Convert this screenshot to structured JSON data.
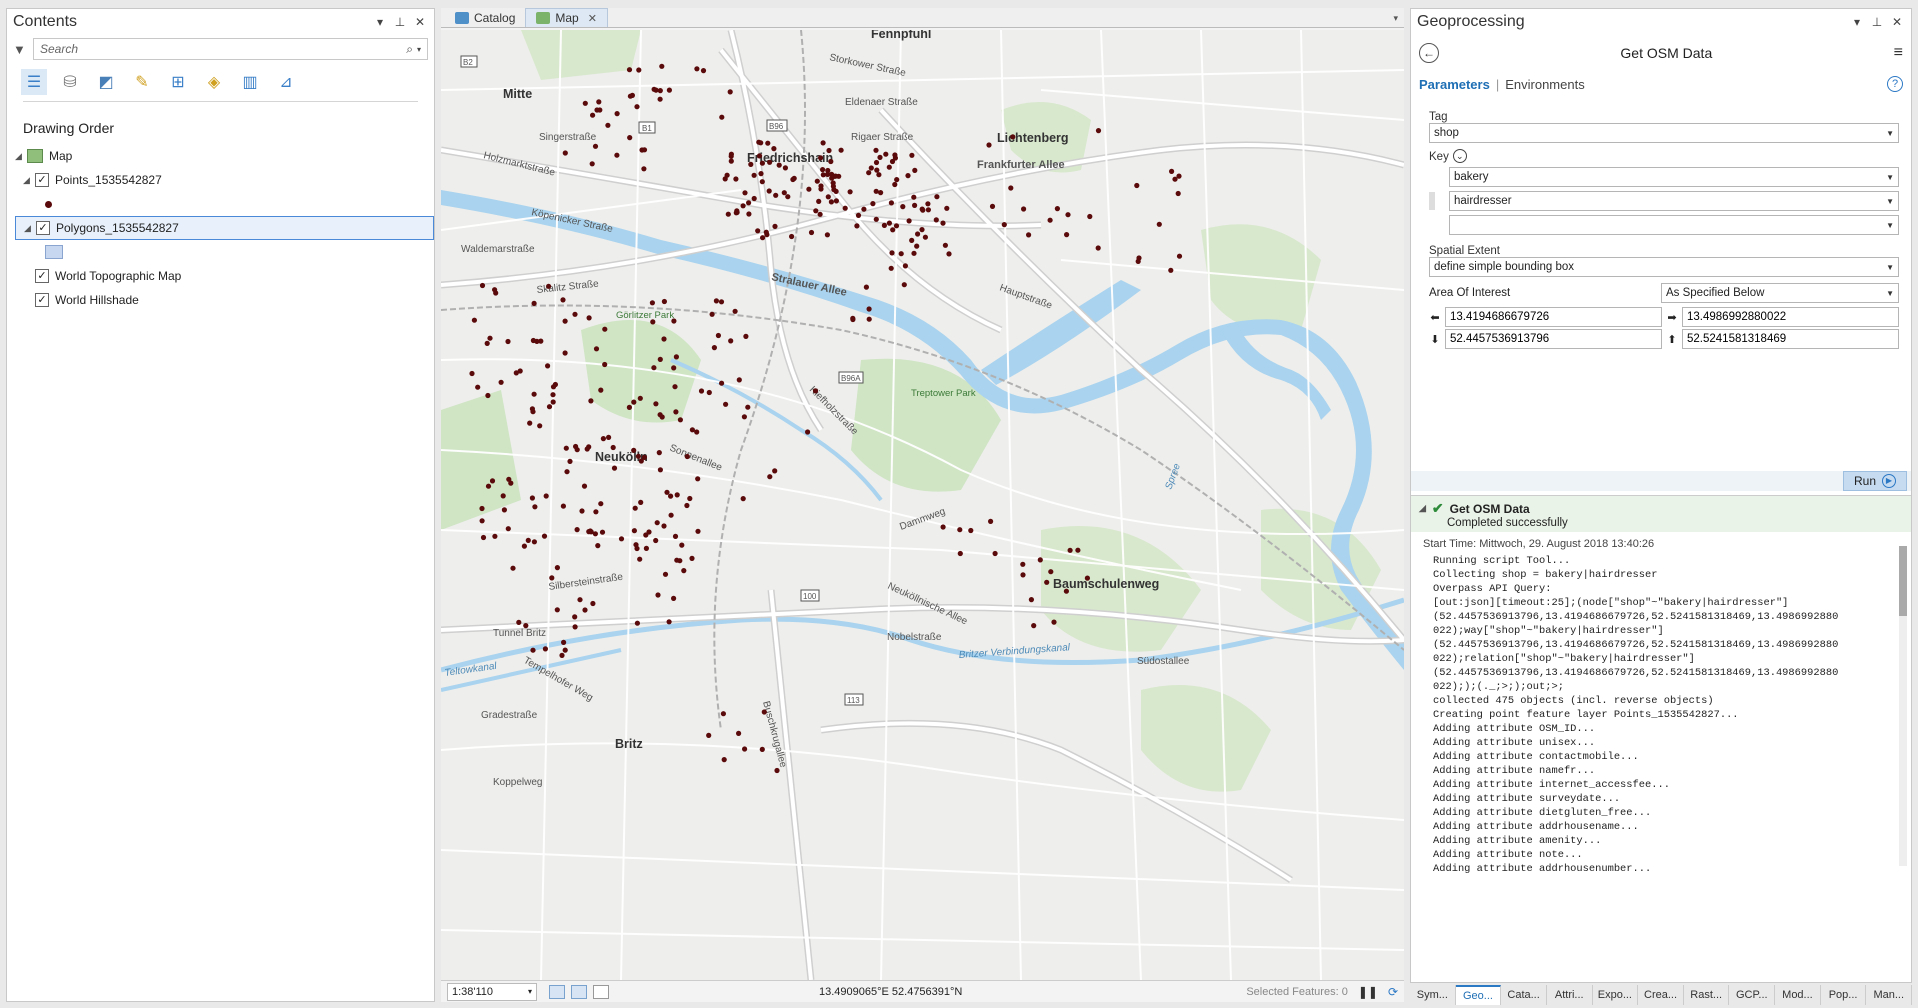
{
  "contents": {
    "title": "Contents",
    "search_placeholder": "Search",
    "drawing_order": "Drawing Order",
    "layers": {
      "map": "Map",
      "points": "Points_1535542827",
      "polygons": "Polygons_1535542827",
      "topo": "World Topographic Map",
      "hillshade": "World Hillshade"
    }
  },
  "map_tabs": {
    "catalog": "Catalog",
    "map": "Map"
  },
  "map_status": {
    "scale": "1:38'110",
    "coordinates": "13.4909065°E 52.4756391°N",
    "selected_features": "Selected Features: 0"
  },
  "map_labels": {
    "mitte": "Mitte",
    "friedrichshain": "Friedrichshain",
    "lichtenberg": "Lichtenberg",
    "neukolln": "Neukölln",
    "baumschulenweg": "Baumschulenweg",
    "britz": "Britz",
    "fennpfuhl": "Fennpfuhl",
    "stralauer": "Stralauer Allee",
    "frankfurter": "Frankfurter Allee",
    "sonnenallee": "Sonnenallee",
    "treptower": "Treptower Park",
    "gorlitzer": "Görlitzer Park",
    "verbindungskanal": "Britzer Verbindungskanal",
    "teltowkanal": "Teltowkanal",
    "tunnel": "Tunnel Britz",
    "spree": "Spree",
    "holzmarkt": "Holzmarktstraße",
    "skalitzer": "Skalitz  Straße",
    "kopenicker": "Köpenicker Straße",
    "waldemar": "Waldemarstraße",
    "landsberger": "Eldenaer Straße",
    "storkower": "Storkower Straße",
    "karl": "Rigaer Straße",
    "singer": "Singerstraße",
    "dammweg": "Dammweg",
    "neukollnische": "Neuköllnische Allee",
    "buschkrug": "Buschkrugallee",
    "gradestr": "Gradestraße",
    "koppelweg": "Koppelweg",
    "tempelhofer": "Tempelhofer Weg",
    "silberstein": "Silbersteinstraße",
    "kiefholz": "Kiefholzstraße",
    "hauptstr": "Hauptstraße",
    "nobel": "Nobelstraße",
    "sudostallee": "Südostallee",
    "b1": "B1",
    "b2": "B2",
    "b96": "B96",
    "b96a": "B96A",
    "r100": "100",
    "r113": "113"
  },
  "geoprocessing": {
    "pane_title": "Geoprocessing",
    "tool_title": "Get OSM Data",
    "tab_parameters": "Parameters",
    "tab_environments": "Environments",
    "tag_label": "Tag",
    "tag_value": "shop",
    "key_label": "Key",
    "keys": [
      "bakery",
      "hairdresser",
      ""
    ],
    "extent_label": "Spatial Extent",
    "extent_value": "define simple bounding box",
    "aoi_label": "Area Of Interest",
    "aoi_mode": "As Specified Below",
    "west": "13.4194686679726",
    "east": "13.4986992880022",
    "south": "52.4457536913796",
    "north": "52.5241581318469",
    "run_label": "Run",
    "msg_title": "Get OSM Data",
    "msg_status": "Completed successfully",
    "start_time": "Start Time: Mittwoch, 29. August 2018 13:40:26",
    "log": "Running script Tool...\nCollecting shop = bakery|hairdresser\nOverpass API Query:\n[out:json][timeout:25];(node[\"shop\"~\"bakery|hairdresser\"]\n(52.4457536913796,13.4194686679726,52.5241581318469,13.4986992880\n022);way[\"shop\"~\"bakery|hairdresser\"]\n(52.4457536913796,13.4194686679726,52.5241581318469,13.4986992880\n022);relation[\"shop\"~\"bakery|hairdresser\"]\n(52.4457536913796,13.4194686679726,52.5241581318469,13.4986992880\n022););(._;>;);out;>;\ncollected 475 objects (incl. reverse objects)\nCreating point feature layer Points_1535542827...\nAdding attribute OSM_ID...\nAdding attribute unisex...\nAdding attribute contactmobile...\nAdding attribute namefr...\nAdding attribute internet_accessfee...\nAdding attribute surveydate...\nAdding attribute dietgluten_free...\nAdding attribute addrhousename...\nAdding attribute amenity...\nAdding attribute note...\nAdding attribute addrhousenumber..."
  },
  "bottom_tabs": [
    "Sym...",
    "Geo...",
    "Cata...",
    "Attri...",
    "Expo...",
    "Crea...",
    "Rast...",
    "GCP...",
    "Mod...",
    "Pop...",
    "Man..."
  ],
  "colors": {
    "accent": "#2b78c5",
    "point": "#5a0a0a",
    "water": "#a9d3ee",
    "park": "#cfe5c4"
  }
}
